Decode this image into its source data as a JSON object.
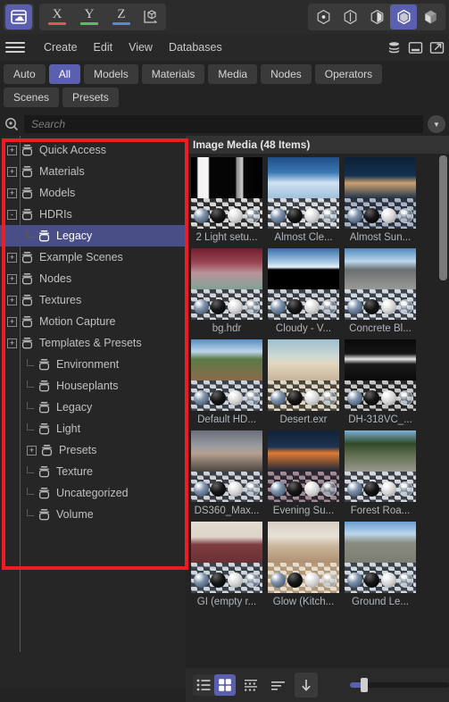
{
  "viewport_toolbar": {
    "home_icon": "archive-home-icon",
    "axes": [
      {
        "label": "X",
        "color": "#e05555"
      },
      {
        "label": "Y",
        "color": "#55c05a"
      },
      {
        "label": "Z",
        "color": "#4f8be0"
      }
    ],
    "gizmo_icon": "axis-gizmo-icon",
    "shading_modes": [
      {
        "name": "point-cloud-icon",
        "active": false
      },
      {
        "name": "wireframe-icon",
        "active": false
      },
      {
        "name": "flat-shade-icon",
        "active": false
      },
      {
        "name": "smooth-shade-icon",
        "active": true
      },
      {
        "name": "textured-shade-icon",
        "active": false
      }
    ]
  },
  "menubar": {
    "hamburger": "hamburger-icon",
    "items": [
      "Create",
      "Edit",
      "View",
      "Databases"
    ],
    "right_icons": [
      "database-stack-icon",
      "dock-panel-icon",
      "pop-out-icon"
    ]
  },
  "filter_tabs": {
    "row1": [
      {
        "label": "Auto",
        "selected": false
      },
      {
        "label": "All",
        "selected": true
      },
      {
        "label": "Models",
        "selected": false
      },
      {
        "label": "Materials",
        "selected": false
      },
      {
        "label": "Media",
        "selected": false
      },
      {
        "label": "Nodes",
        "selected": false
      },
      {
        "label": "Operators",
        "selected": false
      }
    ],
    "row2": [
      {
        "label": "Scenes",
        "selected": false
      },
      {
        "label": "Presets",
        "selected": false
      }
    ]
  },
  "search": {
    "icon": "search-icon",
    "placeholder": "Search",
    "value": "",
    "dropdown_icon": "chevron-down-icon"
  },
  "tree": {
    "items": [
      {
        "label": "Quick Access",
        "depth": 0,
        "expander": "+",
        "selected": false
      },
      {
        "label": "Materials",
        "depth": 0,
        "expander": "+",
        "selected": false
      },
      {
        "label": "Models",
        "depth": 0,
        "expander": "+",
        "selected": false
      },
      {
        "label": "HDRIs",
        "depth": 0,
        "expander": "-",
        "selected": false
      },
      {
        "label": "Legacy",
        "depth": 1,
        "expander": "",
        "selected": true
      },
      {
        "label": "Example Scenes",
        "depth": 0,
        "expander": "+",
        "selected": false
      },
      {
        "label": "Nodes",
        "depth": 0,
        "expander": "+",
        "selected": false
      },
      {
        "label": "Textures",
        "depth": 0,
        "expander": "+",
        "selected": false
      },
      {
        "label": "Motion Capture",
        "depth": 0,
        "expander": "+",
        "selected": false
      },
      {
        "label": "Templates & Presets",
        "depth": 0,
        "expander": "+",
        "selected": false
      },
      {
        "label": "Environment",
        "depth": 1,
        "expander": "",
        "selected": false
      },
      {
        "label": "Houseplants",
        "depth": 1,
        "expander": "",
        "selected": false
      },
      {
        "label": "Legacy",
        "depth": 1,
        "expander": "",
        "selected": false
      },
      {
        "label": "Light",
        "depth": 1,
        "expander": "",
        "selected": false
      },
      {
        "label": "Presets",
        "depth": 1,
        "expander": "+",
        "selected": false
      },
      {
        "label": "Texture",
        "depth": 1,
        "expander": "",
        "selected": false
      },
      {
        "label": "Uncategorized",
        "depth": 1,
        "expander": "",
        "selected": false
      },
      {
        "label": "Volume",
        "depth": 1,
        "expander": "",
        "selected": false
      }
    ]
  },
  "grid": {
    "header": "Image Media (48 Items)",
    "items": [
      {
        "label": "2 Light setu...",
        "sky": "linear-gradient(90deg,#000 0%,#000 8%,#f2f2f2 10%,#f5f5f5 24%,#050505 26%,#050505 62%,#8a8a8a 64%,#cfcfcf 72%,#060606 74%,#000 100%)",
        "floor_dark": "#2b2b2b",
        "floor_light": "#d6d6d6"
      },
      {
        "label": "Almost Cle...",
        "sky": "linear-gradient(180deg,#1e4e86 0%,#3d7ab5 38%,#cfe2f2 62%,#9fc0da 100%)",
        "floor_dark": "#3d4148",
        "floor_light": "#d8dade"
      },
      {
        "label": "Almost Sun...",
        "sky": "linear-gradient(180deg,#0d2036 0%,#14314f 45%,#caa070 63%,#23344a 100%)",
        "floor_dark": "#2a3240",
        "floor_light": "#a8b2c0"
      },
      {
        "label": "bg.hdr",
        "sky": "linear-gradient(180deg,#6e1f2e 0%,#9c4553 35%,#b9949a 60%,#7fa296 100%)",
        "floor_dark": "#3a3f46",
        "floor_light": "#d3d6d9"
      },
      {
        "label": "Cloudy - V...",
        "sky": "linear-gradient(180deg,#3b6ea8 0%,#a8cbe6 34%,#e9f2f8 46%,#000 52%,#000 100%)",
        "floor_dark": "#393d44",
        "floor_light": "#cdd0d5"
      },
      {
        "label": "Concrete Bl...",
        "sky": "linear-gradient(180deg,#4e87bd 0%,#bcd8ec 32%,#6a6f70 52%,#9a9a96 100%)",
        "floor_dark": "#3c434d",
        "floor_light": "#d2d8e0"
      },
      {
        "label": "Default HD...",
        "sky": "linear-gradient(180deg,#5a8cc0 0%,#bcd6ea 30%,#5c7a46 48%,#8a6a4a 100%)",
        "floor_dark": "#3b4049",
        "floor_light": "#ccd2da"
      },
      {
        "label": "Desert.exr",
        "sky": "linear-gradient(180deg,#9ec0cf 0%,#cfd9d4 42%,#e3d7c0 58%,#c7b49a 100%)",
        "floor_dark": "#4a463c",
        "floor_light": "#ddd6c6"
      },
      {
        "label": "DH-318VC_...",
        "sky": "linear-gradient(180deg,#0a0a0a 0%,#151515 35%,#e8e8e8 48%,#1a1a1a 60%,#0a0a0a 100%)",
        "floor_dark": "#262626",
        "floor_light": "#c4c4c4"
      },
      {
        "label": "DS360_Max...",
        "sky": "linear-gradient(180deg,#6b6f7a 0%,#9a9ba0 38%,#b5a08f 56%,#4b453f 100%)",
        "floor_dark": "#3a3e45",
        "floor_light": "#cdd1d7"
      },
      {
        "label": "Evening Su...",
        "sky": "linear-gradient(180deg,#122238 0%,#1d3450 40%,#e07a33 55%,#1a2436 100%)",
        "floor_dark": "#2c2630",
        "floor_light": "#a08a93"
      },
      {
        "label": "Forest Roa...",
        "sky": "linear-gradient(180deg,#7fb0d8 0%,#2f4a28 32%,#5b6a4a 55%,#9a9890 100%)",
        "floor_dark": "#3b4048",
        "floor_light": "#d4d8dd"
      },
      {
        "label": "GI (empty r...",
        "sky": "linear-gradient(180deg,#e4ddd2 0%,#ddd3c6 38%,#7e3d42 56%,#6b3034 100%)",
        "floor_dark": "#3a424c",
        "floor_light": "#cfd4db"
      },
      {
        "label": "Glow (Kitch...",
        "sky": "linear-gradient(180deg,#d6cec2 0%,#e8e2d6 35%,#c9b59c 60%,#b09070 100%)",
        "floor_dark": "#b09878",
        "floor_light": "#e6ddcd"
      },
      {
        "label": "Ground  Le...",
        "sky": "linear-gradient(180deg,#6a9ecf 0%,#bcd6ec 30%,#8a8c82 52%,#7b7d72 100%)",
        "floor_dark": "#3b4149",
        "floor_light": "#d0d6dd"
      }
    ]
  },
  "bottom_bar": {
    "view_list_icon": "list-view-icon",
    "view_grid_icon": "grid-view-icon",
    "view_grid_active": true,
    "detail_icon": "detail-columns-icon",
    "sort_icon": "sort-lines-icon",
    "download_icon": "download-arrow-icon",
    "zoom_slider_value": 10
  },
  "annotation": {
    "type": "highlight-rectangle",
    "color": "#ee1c24"
  }
}
